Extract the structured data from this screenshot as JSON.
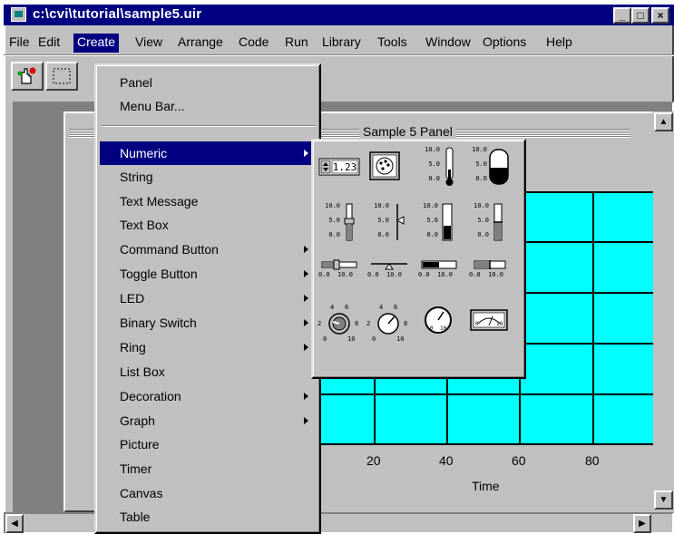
{
  "window": {
    "title": "c:\\cvi\\tutorial\\sample5.uir",
    "controls": {
      "minimize": "_",
      "maximize": "□",
      "close": "×"
    }
  },
  "menubar": [
    {
      "label": "File",
      "selected": false
    },
    {
      "label": "Edit",
      "selected": false
    },
    {
      "label": "Create",
      "selected": true
    },
    {
      "label": "View",
      "selected": false
    },
    {
      "label": "Arrange",
      "selected": false
    },
    {
      "label": "Code",
      "selected": false
    },
    {
      "label": "Run",
      "selected": false
    },
    {
      "label": "Library",
      "selected": false
    },
    {
      "label": "Tools",
      "selected": false
    },
    {
      "label": "Window",
      "selected": false
    },
    {
      "label": "Options",
      "selected": false
    },
    {
      "label": "Help",
      "selected": false
    }
  ],
  "toolbar": {
    "tools": [
      "operate-tool-icon",
      "select-tool-icon"
    ]
  },
  "panel": {
    "title": "Sample 5 Panel"
  },
  "graph": {
    "x_ticks": [
      "20",
      "40",
      "60",
      "80"
    ],
    "x_label": "Time",
    "plot_color": "#00ffff"
  },
  "create_menu": {
    "items": [
      {
        "label": "Panel",
        "submenu": false
      },
      {
        "label": "Menu Bar...",
        "submenu": false
      },
      {
        "label": "Numeric",
        "submenu": true,
        "selected": true
      },
      {
        "label": "String",
        "submenu": false
      },
      {
        "label": "Text Message",
        "submenu": false
      },
      {
        "label": "Text Box",
        "submenu": false
      },
      {
        "label": "Command Button",
        "submenu": true
      },
      {
        "label": "Toggle Button",
        "submenu": true
      },
      {
        "label": "LED",
        "submenu": true
      },
      {
        "label": "Binary Switch",
        "submenu": true
      },
      {
        "label": "Ring",
        "submenu": true
      },
      {
        "label": "List Box",
        "submenu": false
      },
      {
        "label": "Decoration",
        "submenu": true
      },
      {
        "label": "Graph",
        "submenu": true
      },
      {
        "label": "Picture",
        "submenu": false
      },
      {
        "label": "Timer",
        "submenu": false
      },
      {
        "label": "Canvas",
        "submenu": false
      },
      {
        "label": "Table",
        "submenu": false
      }
    ]
  },
  "numeric_submenu": {
    "numeric_display": "1.23",
    "scale_labels": [
      "10.0",
      "5.0",
      "0.0"
    ],
    "slider_ends": [
      "0.0",
      "10.0"
    ],
    "knob_labels": [
      "4",
      "6",
      "2",
      "8",
      "0",
      "10"
    ],
    "controls": [
      "numeric-control-icon",
      "color-numeric-icon",
      "thermometer-icon",
      "tank-icon",
      "vertical-slide-icon",
      "vertical-pointer-slide-icon",
      "vertical-fill-slide-icon",
      "vertical-bar-slide-icon",
      "horizontal-slide-icon",
      "horizontal-pointer-slide-icon",
      "horizontal-fill-slide-icon",
      "horizontal-bar-slide-icon",
      "knob-icon",
      "dial-icon",
      "gauge-icon",
      "meter-icon"
    ]
  }
}
